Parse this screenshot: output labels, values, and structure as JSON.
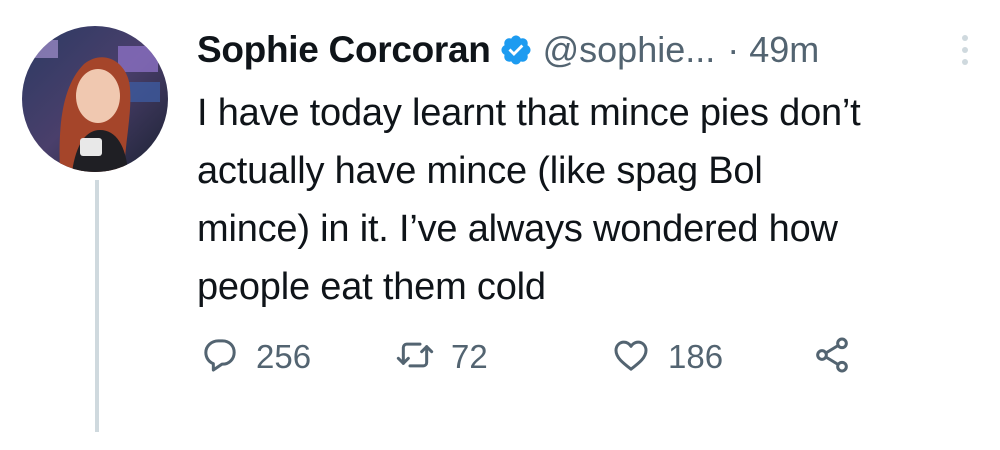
{
  "author": {
    "name": "Sophie Corcoran",
    "handle": "@sophie...",
    "separator": "·",
    "time": "49m",
    "verified": true
  },
  "tweet": {
    "lines": [
      "I have today learnt that mince pies don’t",
      "actually have mince (like spag Bol",
      "mince) in it. I’ve always wondered how",
      "people eat them cold"
    ]
  },
  "actions": {
    "reply_count": "256",
    "retweet_count": "72",
    "like_count": "186"
  },
  "colors": {
    "text_primary": "#0f1419",
    "text_secondary": "#536471",
    "verified_blue": "#1d9bf0",
    "thread_line": "#cfd9de"
  },
  "icons": {
    "verified": "verified-badge-icon",
    "more": "more-options-icon",
    "reply": "reply-icon",
    "retweet": "retweet-icon",
    "like": "heart-icon",
    "share": "share-icon"
  }
}
